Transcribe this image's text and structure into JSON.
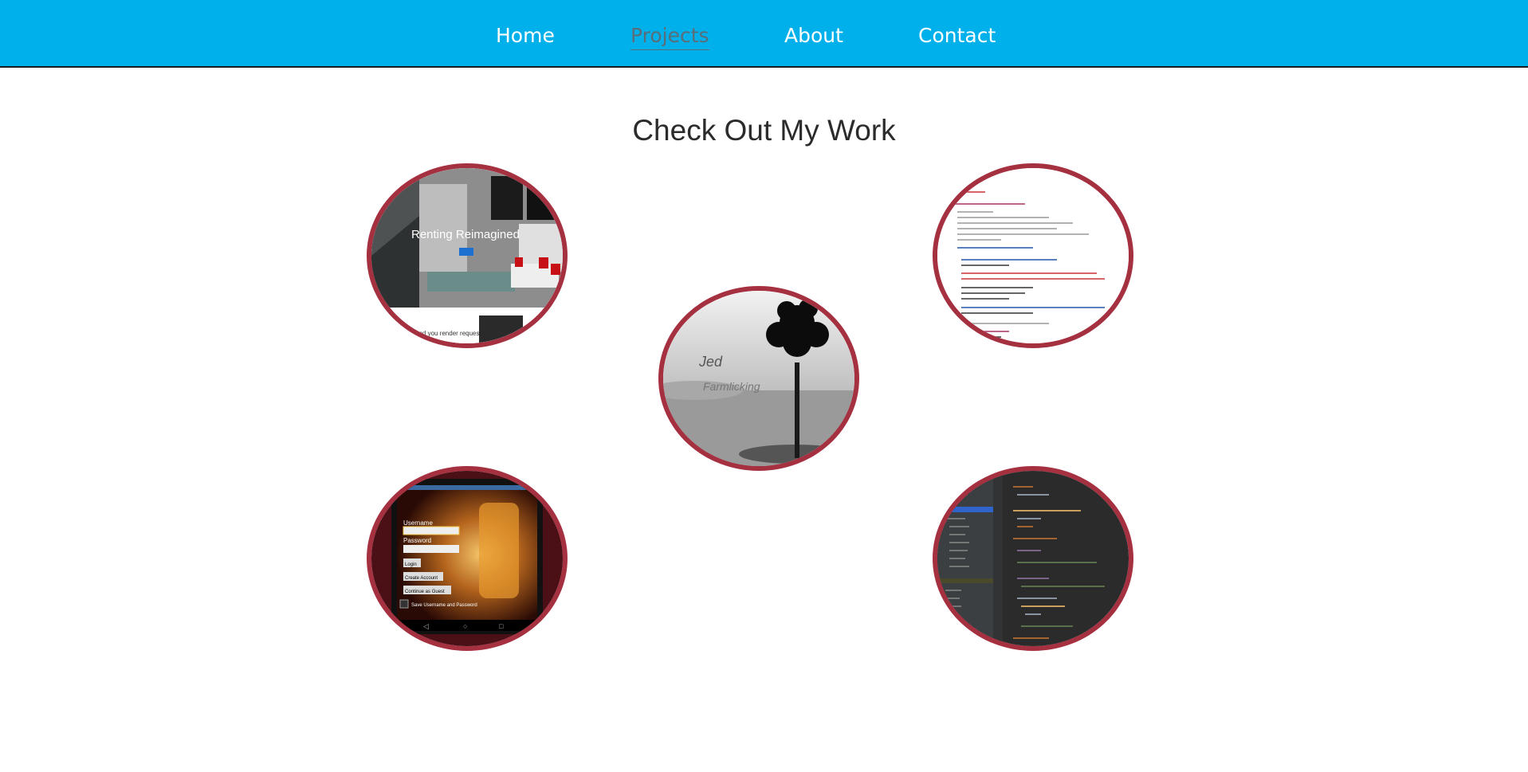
{
  "nav": {
    "items": [
      {
        "label": "Home",
        "active": false
      },
      {
        "label": "Projects",
        "active": true
      },
      {
        "label": "About",
        "active": false
      },
      {
        "label": "Contact",
        "active": false
      }
    ],
    "background": "#00b0ea",
    "active_color": "#5a6e78"
  },
  "main": {
    "title": "Check Out My Work"
  },
  "projects": [
    {
      "thumbnail": "renting-website-screenshot",
      "caption": "Renting Reimagined",
      "subcaption": "and you render requests"
    },
    {
      "thumbnail": "tree-in-lake-logo",
      "caption": "Jed",
      "subcaption": "Farmlicking"
    },
    {
      "thumbnail": "code-editor-light-screenshot"
    },
    {
      "thumbnail": "android-login-app-photo",
      "fields": [
        "Username",
        "Password"
      ],
      "buttons": [
        "Login",
        "Create Account",
        "Continue as Guest"
      ],
      "checkbox": "Save Username and Password"
    },
    {
      "thumbnail": "code-editor-dark-screenshot"
    }
  ],
  "colors": {
    "ring": "#a53040",
    "title": "#2b2b2b"
  }
}
